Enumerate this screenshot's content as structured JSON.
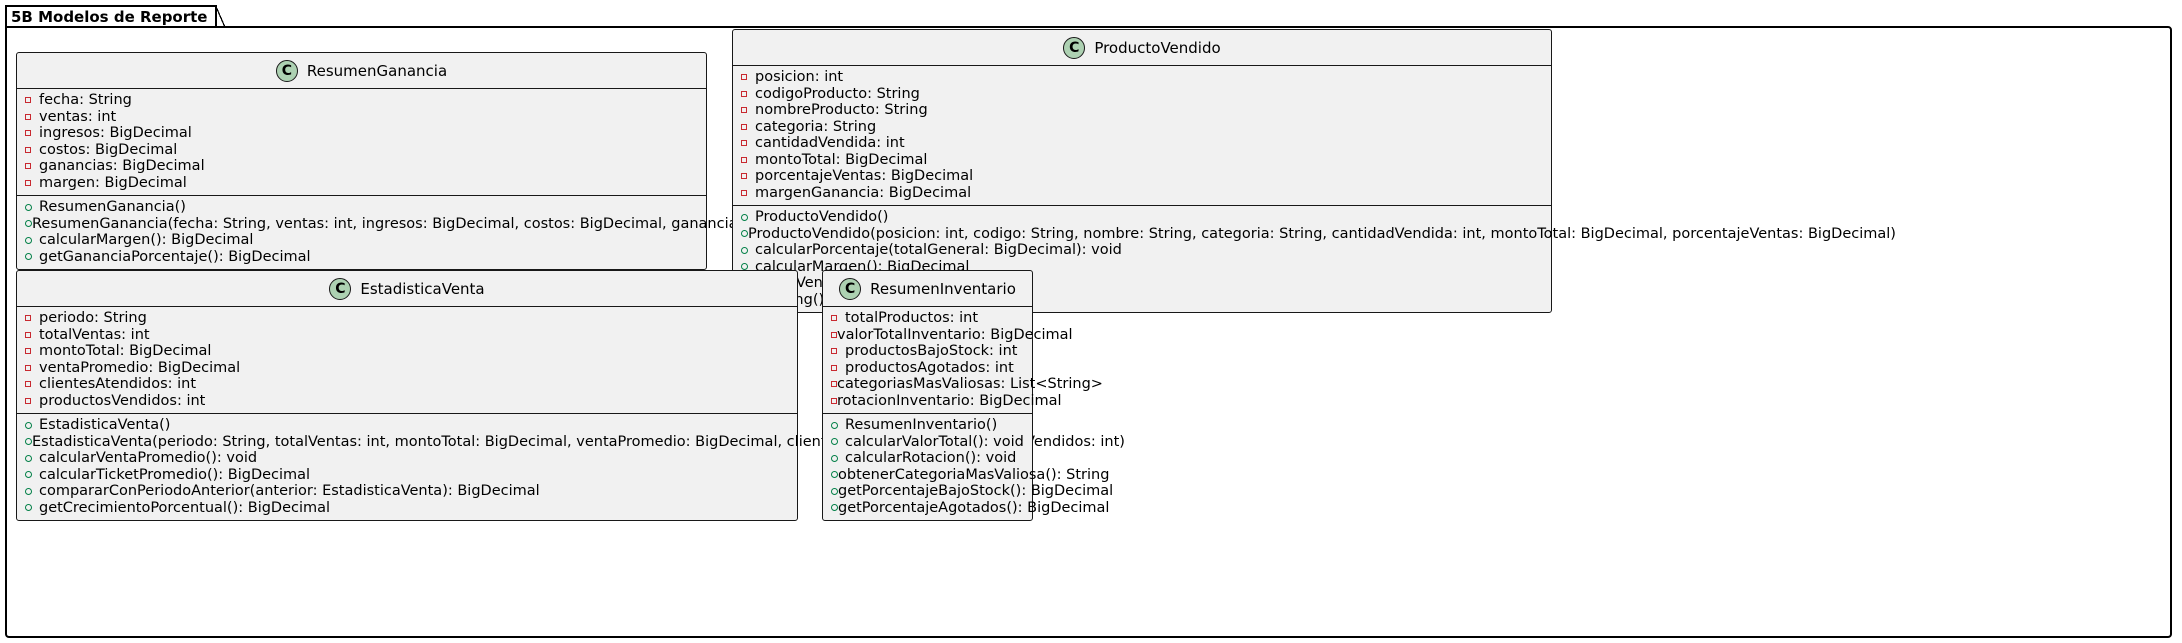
{
  "package": {
    "name": "5B Modelos de Reporte"
  },
  "classes": {
    "resumen_ganancia": {
      "stereotype_icon": "C",
      "name": "ResumenGanancia",
      "attributes": [
        "fecha: String",
        "ventas: int",
        "ingresos: BigDecimal",
        "costos: BigDecimal",
        "ganancias: BigDecimal",
        "margen: BigDecimal"
      ],
      "methods": [
        "ResumenGanancia()",
        "ResumenGanancia(fecha: String, ventas: int, ingresos: BigDecimal, costos: BigDecimal, ganancias: BigDecimal, margen: BigDecimal)",
        "calcularMargen(): BigDecimal",
        "getGananciaPorcentaje(): BigDecimal"
      ]
    },
    "producto_vendido": {
      "stereotype_icon": "C",
      "name": "ProductoVendido",
      "attributes": [
        "posicion: int",
        "codigoProducto: String",
        "nombreProducto: String",
        "categoria: String",
        "cantidadVendida: int",
        "montoTotal: BigDecimal",
        "porcentajeVentas: BigDecimal",
        "margenGanancia: BigDecimal"
      ],
      "methods": [
        "ProductoVendido()",
        "ProductoVendido(posicion: int, codigo: String, nombre: String, categoria: String, cantidadVendida: int, montoTotal: BigDecimal, porcentajeVentas: BigDecimal)",
        "calcularPorcentaje(totalGeneral: BigDecimal): void",
        "calcularMargen(): BigDecimal",
        "esTopVendido(): boolean",
        "toString(): String"
      ]
    },
    "estadistica_venta": {
      "stereotype_icon": "C",
      "name": "EstadisticaVenta",
      "attributes": [
        "periodo: String",
        "totalVentas: int",
        "montoTotal: BigDecimal",
        "ventaPromedio: BigDecimal",
        "clientesAtendidos: int",
        "productosVendidos: int"
      ],
      "methods": [
        "EstadisticaVenta()",
        "EstadisticaVenta(periodo: String, totalVentas: int, montoTotal: BigDecimal, ventaPromedio: BigDecimal, clientesAtendidos: int, productosVendidos: int)",
        "calcularVentaPromedio(): void",
        "calcularTicketPromedio(): BigDecimal",
        "compararConPeriodoAnterior(anterior: EstadisticaVenta): BigDecimal",
        "getCrecimientoPorcentual(): BigDecimal"
      ]
    },
    "resumen_inventario": {
      "stereotype_icon": "C",
      "name": "ResumenInventario",
      "attributes": [
        "totalProductos: int",
        "valorTotalInventario: BigDecimal",
        "productosBajoStock: int",
        "productosAgotados: int",
        "categoriasMasValiosas: List<String>",
        "rotacionInventario: BigDecimal"
      ],
      "methods": [
        "ResumenInventario()",
        "calcularValorTotal(): void",
        "calcularRotacion(): void",
        "obtenerCategoriaMasValiosa(): String",
        "getPorcentajeBajoStock(): BigDecimal",
        "getPorcentajeAgotados(): BigDecimal"
      ]
    }
  },
  "colors": {
    "class_fill": "#f1f1f1",
    "class_icon": "#add1b2",
    "private_marker": "#c82930",
    "public_marker": "#038048"
  }
}
